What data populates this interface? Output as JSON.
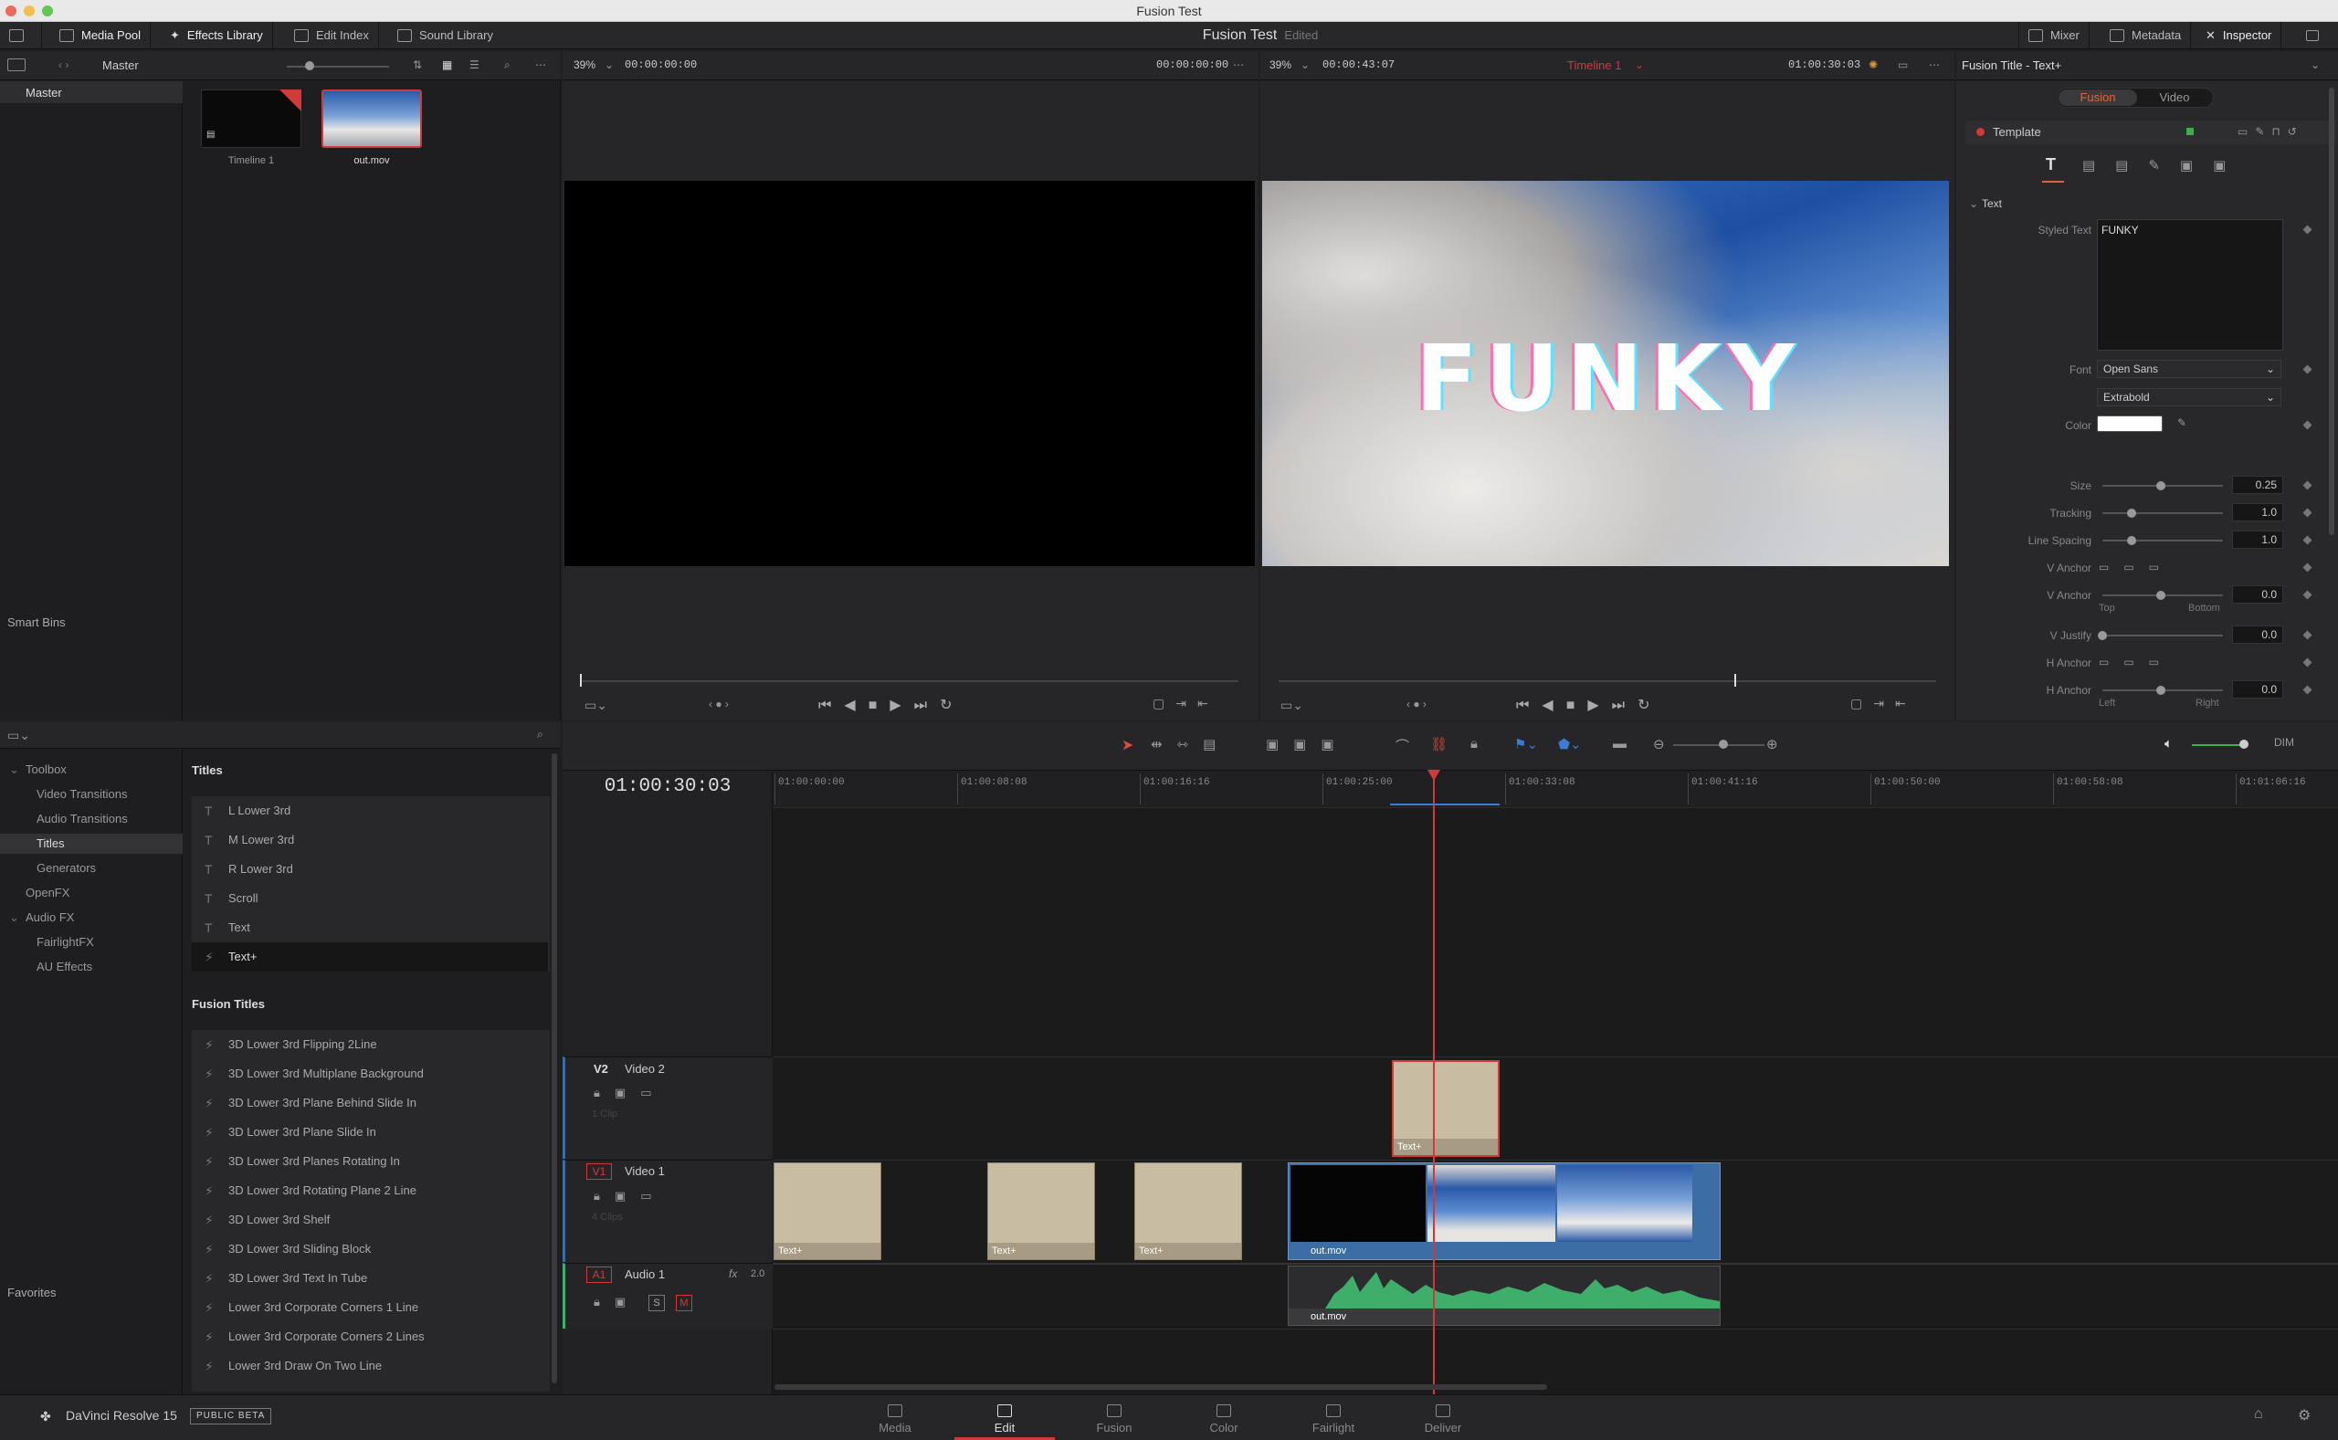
{
  "window": {
    "title": "Fusion Test"
  },
  "toolbar": {
    "media_pool": "Media Pool",
    "effects_library": "Effects Library",
    "edit_index": "Edit Index",
    "sound_library": "Sound Library",
    "project_name": "Fusion Test",
    "project_status": "Edited",
    "mixer": "Mixer",
    "metadata": "Metadata",
    "inspector": "Inspector"
  },
  "media_pool": {
    "bin_name": "Master",
    "bins": [
      "Master"
    ],
    "smart_bins": "Smart Bins",
    "clips": [
      {
        "name": "Timeline 1"
      },
      {
        "name": "out.mov"
      }
    ]
  },
  "source_viewer": {
    "zoom": "39%",
    "timecode_left": "00:00:00:00",
    "timecode_right": "00:00:00:00"
  },
  "timeline_viewer": {
    "zoom": "39%",
    "duration": "00:00:43:07",
    "timeline_name": "Timeline 1",
    "timecode": "01:00:30:03",
    "overlay_text": "FUNKY"
  },
  "effects_library": {
    "toolbox_label": "Toolbox",
    "tree": [
      {
        "label": "Toolbox",
        "level": 0,
        "expanded": true
      },
      {
        "label": "Video Transitions",
        "level": 1
      },
      {
        "label": "Audio Transitions",
        "level": 1
      },
      {
        "label": "Titles",
        "level": 1,
        "selected": true
      },
      {
        "label": "Generators",
        "level": 1
      },
      {
        "label": "OpenFX",
        "level": 0
      },
      {
        "label": "Audio FX",
        "level": 0,
        "expanded": true
      },
      {
        "label": "FairlightFX",
        "level": 1
      },
      {
        "label": "AU Effects",
        "level": 1
      }
    ],
    "favorites": "Favorites",
    "titles_header": "Titles",
    "titles": [
      "L Lower 3rd",
      "M Lower 3rd",
      "R Lower 3rd",
      "Scroll",
      "Text",
      "Text+"
    ],
    "fusion_titles_header": "Fusion Titles",
    "fusion_titles": [
      "3D Lower 3rd Flipping 2Line",
      "3D Lower 3rd Multiplane Background",
      "3D Lower 3rd Plane Behind Slide In",
      "3D Lower 3rd Plane Slide In",
      "3D Lower 3rd Planes Rotating In",
      "3D Lower 3rd Rotating Plane 2 Line",
      "3D Lower 3rd Shelf",
      "3D Lower 3rd Sliding Block",
      "3D Lower 3rd Text In Tube",
      "Lower 3rd Corporate Corners 1 Line",
      "Lower 3rd Corporate Corners 2 Lines",
      "Lower 3rd Draw On Two Line"
    ]
  },
  "timeline": {
    "current_timecode": "01:00:30:03",
    "ruler": [
      "01:00:00:00",
      "01:00:08:08",
      "01:00:16:16",
      "01:00:25:00",
      "01:00:33:08",
      "01:00:41:16",
      "01:00:50:00",
      "01:00:58:08",
      "01:01:06:16"
    ],
    "tracks": [
      {
        "id": "V2",
        "name": "Video 2",
        "count": "1 Clip"
      },
      {
        "id": "V1",
        "name": "Video 1",
        "count": "4 Clips"
      },
      {
        "id": "A1",
        "name": "Audio 1",
        "channels": "2.0",
        "fx": "fx",
        "solo": "S",
        "mute": "M"
      }
    ],
    "clip_label_text": "Text+",
    "clip_label_movie": "out.mov"
  },
  "inspector": {
    "title": "Fusion Title - Text+",
    "tab_fusion": "Fusion",
    "tab_video": "Video",
    "template": "Template",
    "section_text": "Text",
    "styled_text_label": "Styled Text",
    "styled_text_value": "FUNKY",
    "font_label": "Font",
    "font_value": "Open Sans",
    "font_style": "Extrabold",
    "color_label": "Color",
    "color_value": "#ffffff",
    "size_label": "Size",
    "size_value": "0.25",
    "tracking_label": "Tracking",
    "tracking_value": "1.0",
    "line_spacing_label": "Line Spacing",
    "line_spacing_value": "1.0",
    "v_anchor_label": "V Anchor",
    "v_anchor_label2": "V Anchor",
    "v_anchor_value": "0.0",
    "v_anchor_top": "Top",
    "v_anchor_bottom": "Bottom",
    "v_justify_label": "V Justify",
    "v_justify_value": "0.0",
    "h_anchor_label": "H Anchor",
    "h_anchor_label2": "H Anchor",
    "h_anchor_value": "0.0",
    "h_anchor_left": "Left",
    "h_anchor_right": "Right"
  },
  "bottom_bar": {
    "app_name": "DaVinci Resolve 15",
    "beta_badge": "PUBLIC BETA",
    "pages": [
      "Media",
      "Edit",
      "Fusion",
      "Color",
      "Fairlight",
      "Deliver"
    ],
    "active_page": "Edit"
  },
  "colors": {
    "accent_red": "#d13a3a",
    "clip_beige": "#c8bca2",
    "clip_blue": "#3c6ea5",
    "audio_green": "#3fae6a"
  }
}
